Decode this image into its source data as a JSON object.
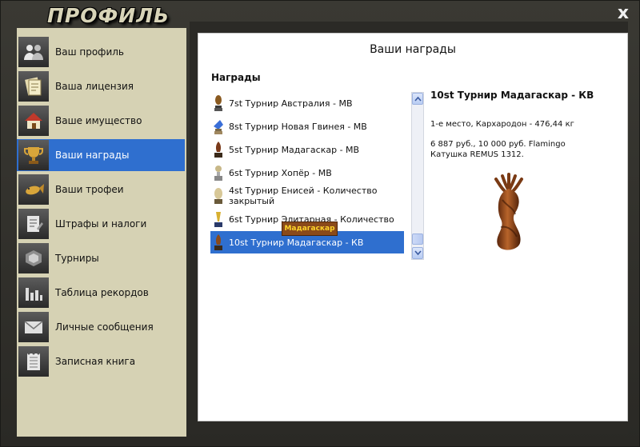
{
  "window": {
    "title": "ПРОФИЛЬ",
    "close_label": "x"
  },
  "sidebar": {
    "items": [
      {
        "label": "Ваш профиль",
        "icon": "users-icon"
      },
      {
        "label": "Ваша лицензия",
        "icon": "license-icon"
      },
      {
        "label": "Ваше имущество",
        "icon": "house-icon"
      },
      {
        "label": "Ваши награды",
        "icon": "trophy-icon",
        "selected": true
      },
      {
        "label": "Ваши трофеи",
        "icon": "fish-icon"
      },
      {
        "label": "Штрафы и налоги",
        "icon": "document-icon"
      },
      {
        "label": "Турниры",
        "icon": "tournament-icon"
      },
      {
        "label": "Таблица рекордов",
        "icon": "bar-chart-icon"
      },
      {
        "label": "Личные сообщения",
        "icon": "envelope-icon"
      },
      {
        "label": "Записная книга",
        "icon": "notebook-icon"
      }
    ]
  },
  "panel": {
    "title": "Ваши награды",
    "awards_heading": "Награды",
    "awards": [
      {
        "name": "7st Турнир Австралия - МВ"
      },
      {
        "name": "8st Турнир Новая Гвинея - МВ"
      },
      {
        "name": "5st Турнир Мадагаскар - МВ"
      },
      {
        "name": "6st Турнир Хопёр - МВ"
      },
      {
        "name": "4st Турнир Енисей - Количество закрытый"
      },
      {
        "name": "6st Турнир Элитарная - Количество"
      },
      {
        "name": "10st Турнир Мадагаскар - КВ",
        "selected": true
      }
    ],
    "detail": {
      "title": "10st Турнир Мадагаскар - КВ",
      "place": "1-е место, Кархародон - 476,44 кг",
      "prize": "6 887 руб., 10 000 руб. Flamingo Катушка REMUS 1312.",
      "plate": "Мадагаскар"
    }
  },
  "colors": {
    "selection": "#2f6fcf",
    "sidebar_bg": "#d6d2b4",
    "frame_bg": "#2b2a26"
  }
}
